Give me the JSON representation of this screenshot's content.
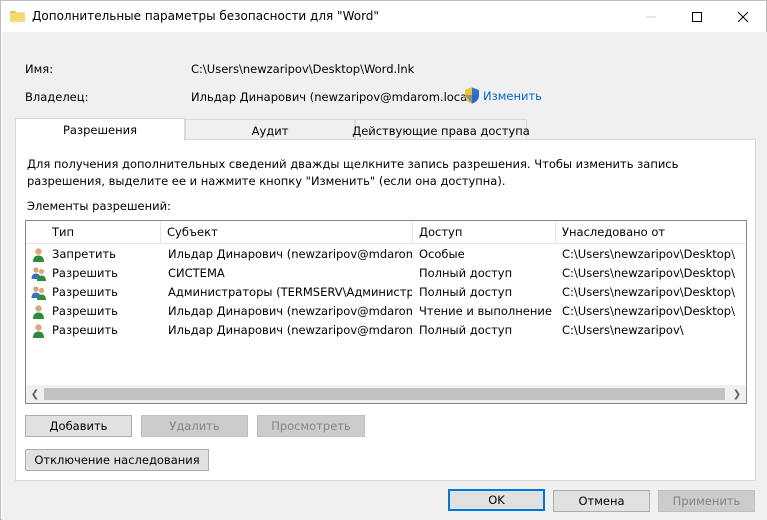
{
  "window": {
    "title": "Дополнительные параметры безопасности  для \"Word\""
  },
  "info": {
    "name_label": "Имя:",
    "name_value": "C:\\Users\\newzaripov\\Desktop\\Word.lnk",
    "owner_label": "Владелец:",
    "owner_value": "Ильдар Динарович (newzaripov@mdarom.local)",
    "change_link": "Изменить"
  },
  "tabs": [
    {
      "label": "Разрешения",
      "active": true
    },
    {
      "label": "Аудит",
      "active": false
    },
    {
      "label": "Действующие права доступа",
      "active": false
    }
  ],
  "permissions": {
    "description": "Для получения дополнительных сведений дважды щелкните запись разрешения. Чтобы изменить запись разрешения, выделите ее и нажмите кнопку \"Изменить\" (если она доступна).",
    "list_label": "Элементы разрешений:",
    "columns": [
      "Тип",
      "Субъект",
      "Доступ",
      "Унаследовано от"
    ],
    "rows": [
      {
        "icon": "user-icon",
        "type": "Запретить",
        "subject": "Ильдар Динарович (newzaripov@mdarom....",
        "access": "Особые",
        "inherited": "C:\\Users\\newzaripov\\Desktop\\"
      },
      {
        "icon": "users-group-icon",
        "type": "Разрешить",
        "subject": "СИСТЕМА",
        "access": "Полный доступ",
        "inherited": "C:\\Users\\newzaripov\\Desktop\\"
      },
      {
        "icon": "users-group-icon",
        "type": "Разрешить",
        "subject": "Администраторы (TERMSERV\\Администр...",
        "access": "Полный доступ",
        "inherited": "C:\\Users\\newzaripov\\Desktop\\"
      },
      {
        "icon": "user-icon",
        "type": "Разрешить",
        "subject": "Ильдар Динарович (newzaripov@mdarom....",
        "access": "Чтение и выполнение",
        "inherited": "C:\\Users\\newzaripov\\Desktop\\"
      },
      {
        "icon": "user-icon",
        "type": "Разрешить",
        "subject": "Ильдар Динарович (newzaripov@mdarom....",
        "access": "Полный доступ",
        "inherited": "C:\\Users\\newzaripov\\"
      }
    ]
  },
  "buttons": {
    "add": "Добавить",
    "remove": "Удалить",
    "view": "Просмотреть",
    "disable_inheritance": "Отключение наследования",
    "ok": "OK",
    "cancel": "Отмена",
    "apply": "Применить"
  },
  "colors": {
    "link": "#0066cc",
    "default_button_border": "#0078d7",
    "dialog_background": "#f0f0f0"
  }
}
